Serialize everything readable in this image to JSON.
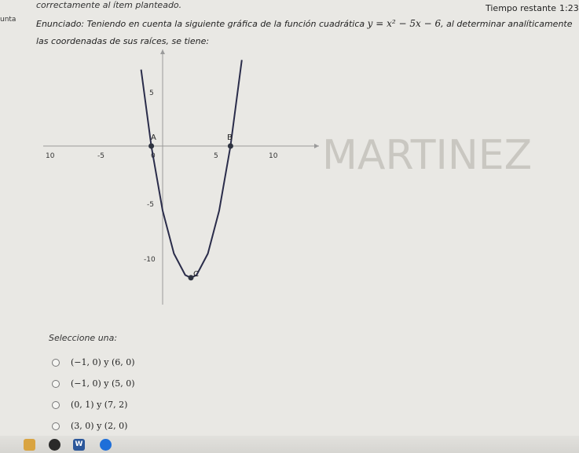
{
  "header": {
    "instruction": "correctamente al ítem planteado.",
    "timer_label": "Tiempo restante",
    "timer_value": "1:23",
    "left_label": "unta"
  },
  "question": {
    "statement_part1": "Enunciado: Teniendo en cuenta la siguiente gráfica de la función cuadrática",
    "equation": "y = x² − 5x − 6",
    "statement_part2": ", al determinar analíticamente las coordenadas de sus raíces, se tiene:"
  },
  "graph": {
    "x_ticks": [
      "10",
      "-5",
      "0",
      "5",
      "10"
    ],
    "y_ticks": [
      "5",
      "-5",
      "-10"
    ],
    "point_labels": [
      "A",
      "B",
      "C"
    ],
    "watermark": "MARTINEZ"
  },
  "chart_data": {
    "type": "line",
    "title": "",
    "function": "y = x^2 - 5x - 6",
    "x": [
      -1.9,
      -1,
      0,
      1,
      2,
      2.5,
      3,
      4,
      5,
      6,
      7
    ],
    "y": [
      7.11,
      0,
      -6,
      -10,
      -12,
      -12.25,
      -12,
      -10,
      -6,
      0,
      8
    ],
    "points": [
      {
        "label": "A",
        "x": -1,
        "y": 0
      },
      {
        "label": "B",
        "x": 6,
        "y": 0
      },
      {
        "label": "C",
        "x": 2.5,
        "y": -12.25
      }
    ],
    "xlabel": "",
    "ylabel": ""
  },
  "answers": {
    "prompt": "Seleccione una:",
    "options": [
      "(−1, 0)  y  (6, 0)",
      "(−1, 0)  y  (5, 0)",
      "(0, 1)  y  (7, 2)",
      "(3, 0)  y  (2, 0)"
    ]
  },
  "taskbar": {
    "word_icon_label": "W"
  },
  "colors": {
    "curve": "#2a2c4a",
    "axis": "#9a9a9a",
    "point": "#2e3340",
    "background": "#e9e8e4"
  }
}
